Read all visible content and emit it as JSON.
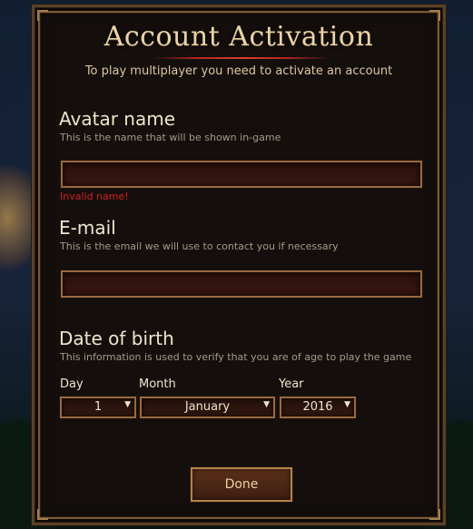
{
  "dialog": {
    "title": "Account Activation",
    "subtitle": "To play multiplayer you need to activate an account"
  },
  "avatar": {
    "title": "Avatar name",
    "description": "This is the name that will be shown in-game",
    "value": "",
    "error": "Invalid name!"
  },
  "email": {
    "title": "E-mail",
    "description": "This is the email we will use to contact you if necessary",
    "value": ""
  },
  "dob": {
    "title": "Date of birth",
    "description": "This information is used to verify that you are of age to play the game",
    "day_label": "Day",
    "month_label": "Month",
    "year_label": "Year",
    "day_value": "1",
    "month_value": "January",
    "year_value": "2016"
  },
  "actions": {
    "done_label": "Done"
  },
  "colors": {
    "accent": "#b3834b",
    "error": "#d21f1f"
  },
  "icons": {
    "dropdown": "triangle-down"
  }
}
